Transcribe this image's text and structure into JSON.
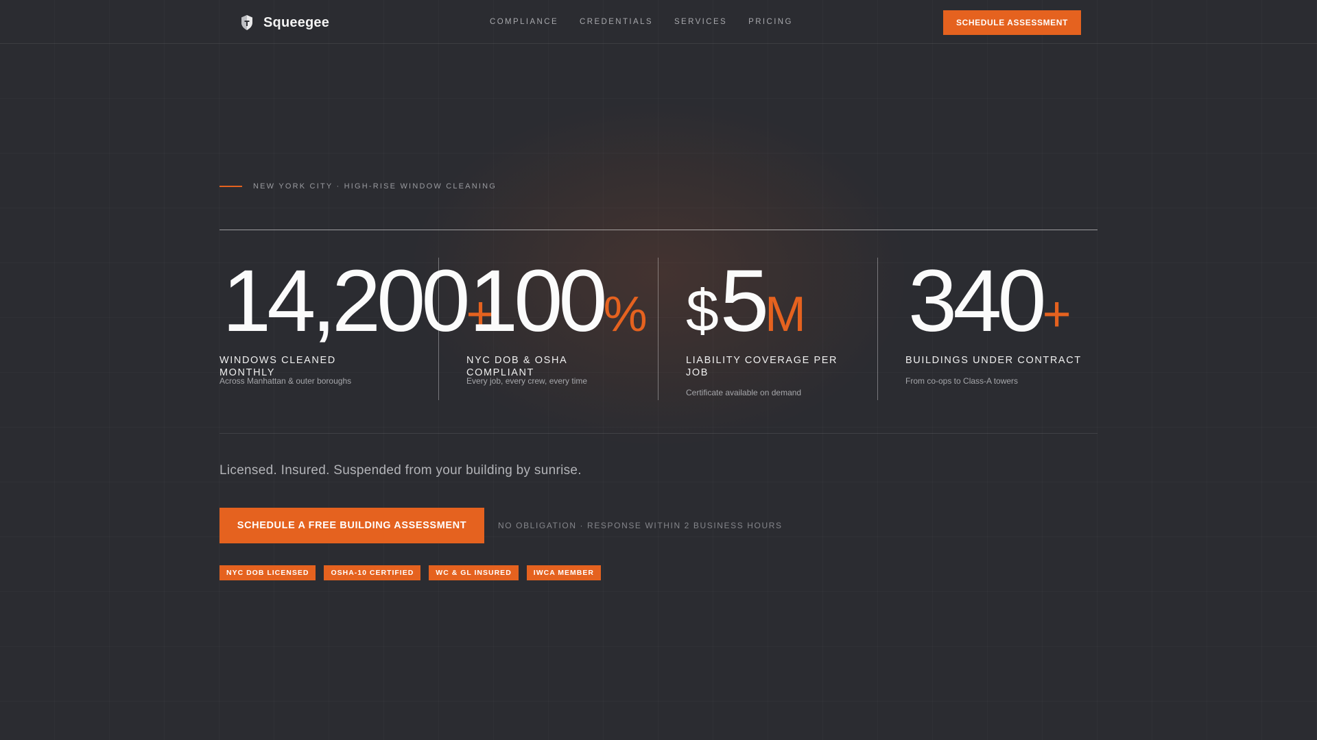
{
  "brand": {
    "name": "Squeegee",
    "logo_icon": "shield-icon",
    "accent_color": "#e5621f",
    "background_color": "#2b2c31"
  },
  "nav": {
    "links": [
      "COMPLIANCE",
      "CREDENTIALS",
      "SERVICES",
      "PRICING"
    ],
    "cta_label": "SCHEDULE ASSESSMENT"
  },
  "hero": {
    "eyebrow": "NEW YORK CITY · HIGH-RISE WINDOW CLEANING",
    "stats": [
      {
        "prefix": "",
        "value": "14,200",
        "suffix": "+",
        "label": "WINDOWS CLEANED MONTHLY",
        "description": "Across Manhattan & outer boroughs"
      },
      {
        "prefix": "",
        "value": "100",
        "suffix": "%",
        "label": "NYC DOB & OSHA COMPLIANT",
        "description": "Every job, every crew, every time"
      },
      {
        "prefix": "$",
        "value": "5",
        "suffix": "M",
        "label": "LIABILITY COVERAGE PER JOB",
        "description": "Certificate available on demand"
      },
      {
        "prefix": "",
        "value": "340",
        "suffix": "+",
        "label": "BUILDINGS UNDER CONTRACT",
        "description": "From co-ops to Class-A towers"
      }
    ],
    "tagline": "Licensed. Insured. Suspended from your building by sunrise.",
    "cta_label": "SCHEDULE A FREE BUILDING ASSESSMENT",
    "cta_note": "NO OBLIGATION · RESPONSE WITHIN 2 BUSINESS HOURS",
    "badges": [
      "NYC DOB LICENSED",
      "OSHA-10 CERTIFIED",
      "WC & GL INSURED",
      "IWCA MEMBER"
    ]
  }
}
